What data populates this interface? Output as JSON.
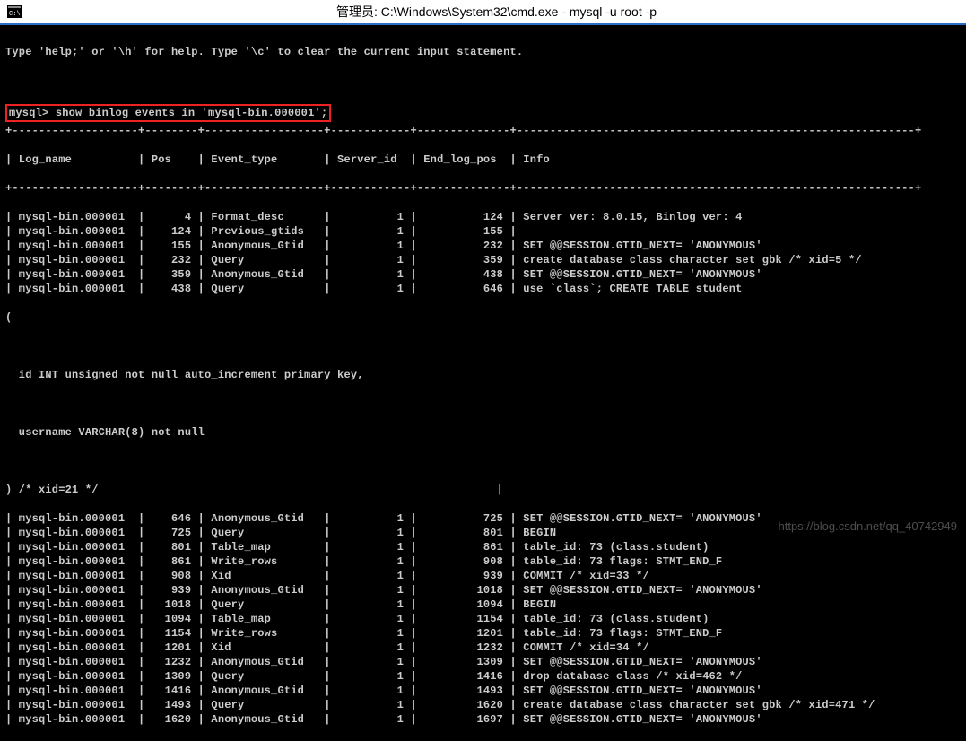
{
  "window": {
    "title": "管理员: C:\\Windows\\System32\\cmd.exe - mysql  -u root -p"
  },
  "intro": {
    "help_line": "Type 'help;' or '\\h' for help. Type '\\c' to clear the current input statement."
  },
  "prompt": {
    "prefix": "mysql>",
    "command": "show binlog events in 'mysql-bin.000001';"
  },
  "headers": {
    "c1": "Log_name",
    "c2": "Pos",
    "c3": "Event_type",
    "c4": "Server_id",
    "c5": "End_log_pos",
    "c6": "Info"
  },
  "rows1": [
    {
      "log": "mysql-bin.000001",
      "pos": "4",
      "ev": "Format_desc",
      "sid": "1",
      "end": "124",
      "info": "Server ver: 8.0.15, Binlog ver: 4"
    },
    {
      "log": "mysql-bin.000001",
      "pos": "124",
      "ev": "Previous_gtids",
      "sid": "1",
      "end": "155",
      "info": ""
    },
    {
      "log": "mysql-bin.000001",
      "pos": "155",
      "ev": "Anonymous_Gtid",
      "sid": "1",
      "end": "232",
      "info": "SET @@SESSION.GTID_NEXT= 'ANONYMOUS'"
    },
    {
      "log": "mysql-bin.000001",
      "pos": "232",
      "ev": "Query",
      "sid": "1",
      "end": "359",
      "info": "create database class character set gbk /* xid=5 */"
    },
    {
      "log": "mysql-bin.000001",
      "pos": "359",
      "ev": "Anonymous_Gtid",
      "sid": "1",
      "end": "438",
      "info": "SET @@SESSION.GTID_NEXT= 'ANONYMOUS'"
    },
    {
      "log": "mysql-bin.000001",
      "pos": "438",
      "ev": "Query",
      "sid": "1",
      "end": "646",
      "info": "use `class`; CREATE TABLE student"
    }
  ],
  "cont": {
    "paren": "(",
    "l1": "  id INT unsigned not null auto_increment primary key,",
    "l2": "  username VARCHAR(8) not null",
    "xid": ") /* xid=21 */"
  },
  "rows2": [
    {
      "log": "mysql-bin.000001",
      "pos": "646",
      "ev": "Anonymous_Gtid",
      "sid": "1",
      "end": "725",
      "info": "SET @@SESSION.GTID_NEXT= 'ANONYMOUS'"
    },
    {
      "log": "mysql-bin.000001",
      "pos": "725",
      "ev": "Query",
      "sid": "1",
      "end": "801",
      "info": "BEGIN"
    },
    {
      "log": "mysql-bin.000001",
      "pos": "801",
      "ev": "Table_map",
      "sid": "1",
      "end": "861",
      "info": "table_id: 73 (class.student)"
    },
    {
      "log": "mysql-bin.000001",
      "pos": "861",
      "ev": "Write_rows",
      "sid": "1",
      "end": "908",
      "info": "table_id: 73 flags: STMT_END_F"
    },
    {
      "log": "mysql-bin.000001",
      "pos": "908",
      "ev": "Xid",
      "sid": "1",
      "end": "939",
      "info": "COMMIT /* xid=33 */"
    },
    {
      "log": "mysql-bin.000001",
      "pos": "939",
      "ev": "Anonymous_Gtid",
      "sid": "1",
      "end": "1018",
      "info": "SET @@SESSION.GTID_NEXT= 'ANONYMOUS'"
    },
    {
      "log": "mysql-bin.000001",
      "pos": "1018",
      "ev": "Query",
      "sid": "1",
      "end": "1094",
      "info": "BEGIN"
    },
    {
      "log": "mysql-bin.000001",
      "pos": "1094",
      "ev": "Table_map",
      "sid": "1",
      "end": "1154",
      "info": "table_id: 73 (class.student)"
    },
    {
      "log": "mysql-bin.000001",
      "pos": "1154",
      "ev": "Write_rows",
      "sid": "1",
      "end": "1201",
      "info": "table_id: 73 flags: STMT_END_F"
    },
    {
      "log": "mysql-bin.000001",
      "pos": "1201",
      "ev": "Xid",
      "sid": "1",
      "end": "1232",
      "info": "COMMIT /* xid=34 */"
    },
    {
      "log": "mysql-bin.000001",
      "pos": "1232",
      "ev": "Anonymous_Gtid",
      "sid": "1",
      "end": "1309",
      "info": "SET @@SESSION.GTID_NEXT= 'ANONYMOUS'"
    },
    {
      "log": "mysql-bin.000001",
      "pos": "1309",
      "ev": "Query",
      "sid": "1",
      "end": "1416",
      "info": "drop database class /* xid=462 */"
    },
    {
      "log": "mysql-bin.000001",
      "pos": "1416",
      "ev": "Anonymous_Gtid",
      "sid": "1",
      "end": "1493",
      "info": "SET @@SESSION.GTID_NEXT= 'ANONYMOUS'"
    },
    {
      "log": "mysql-bin.000001",
      "pos": "1493",
      "ev": "Query",
      "sid": "1",
      "end": "1620",
      "info": "create database class character set gbk /* xid=471 */"
    },
    {
      "log": "mysql-bin.000001",
      "pos": "1620",
      "ev": "Anonymous_Gtid",
      "sid": "1",
      "end": "1697",
      "info": "SET @@SESSION.GTID_NEXT= 'ANONYMOUS'"
    }
  ],
  "watermark": "https://blog.csdn.net/qq_40742949"
}
